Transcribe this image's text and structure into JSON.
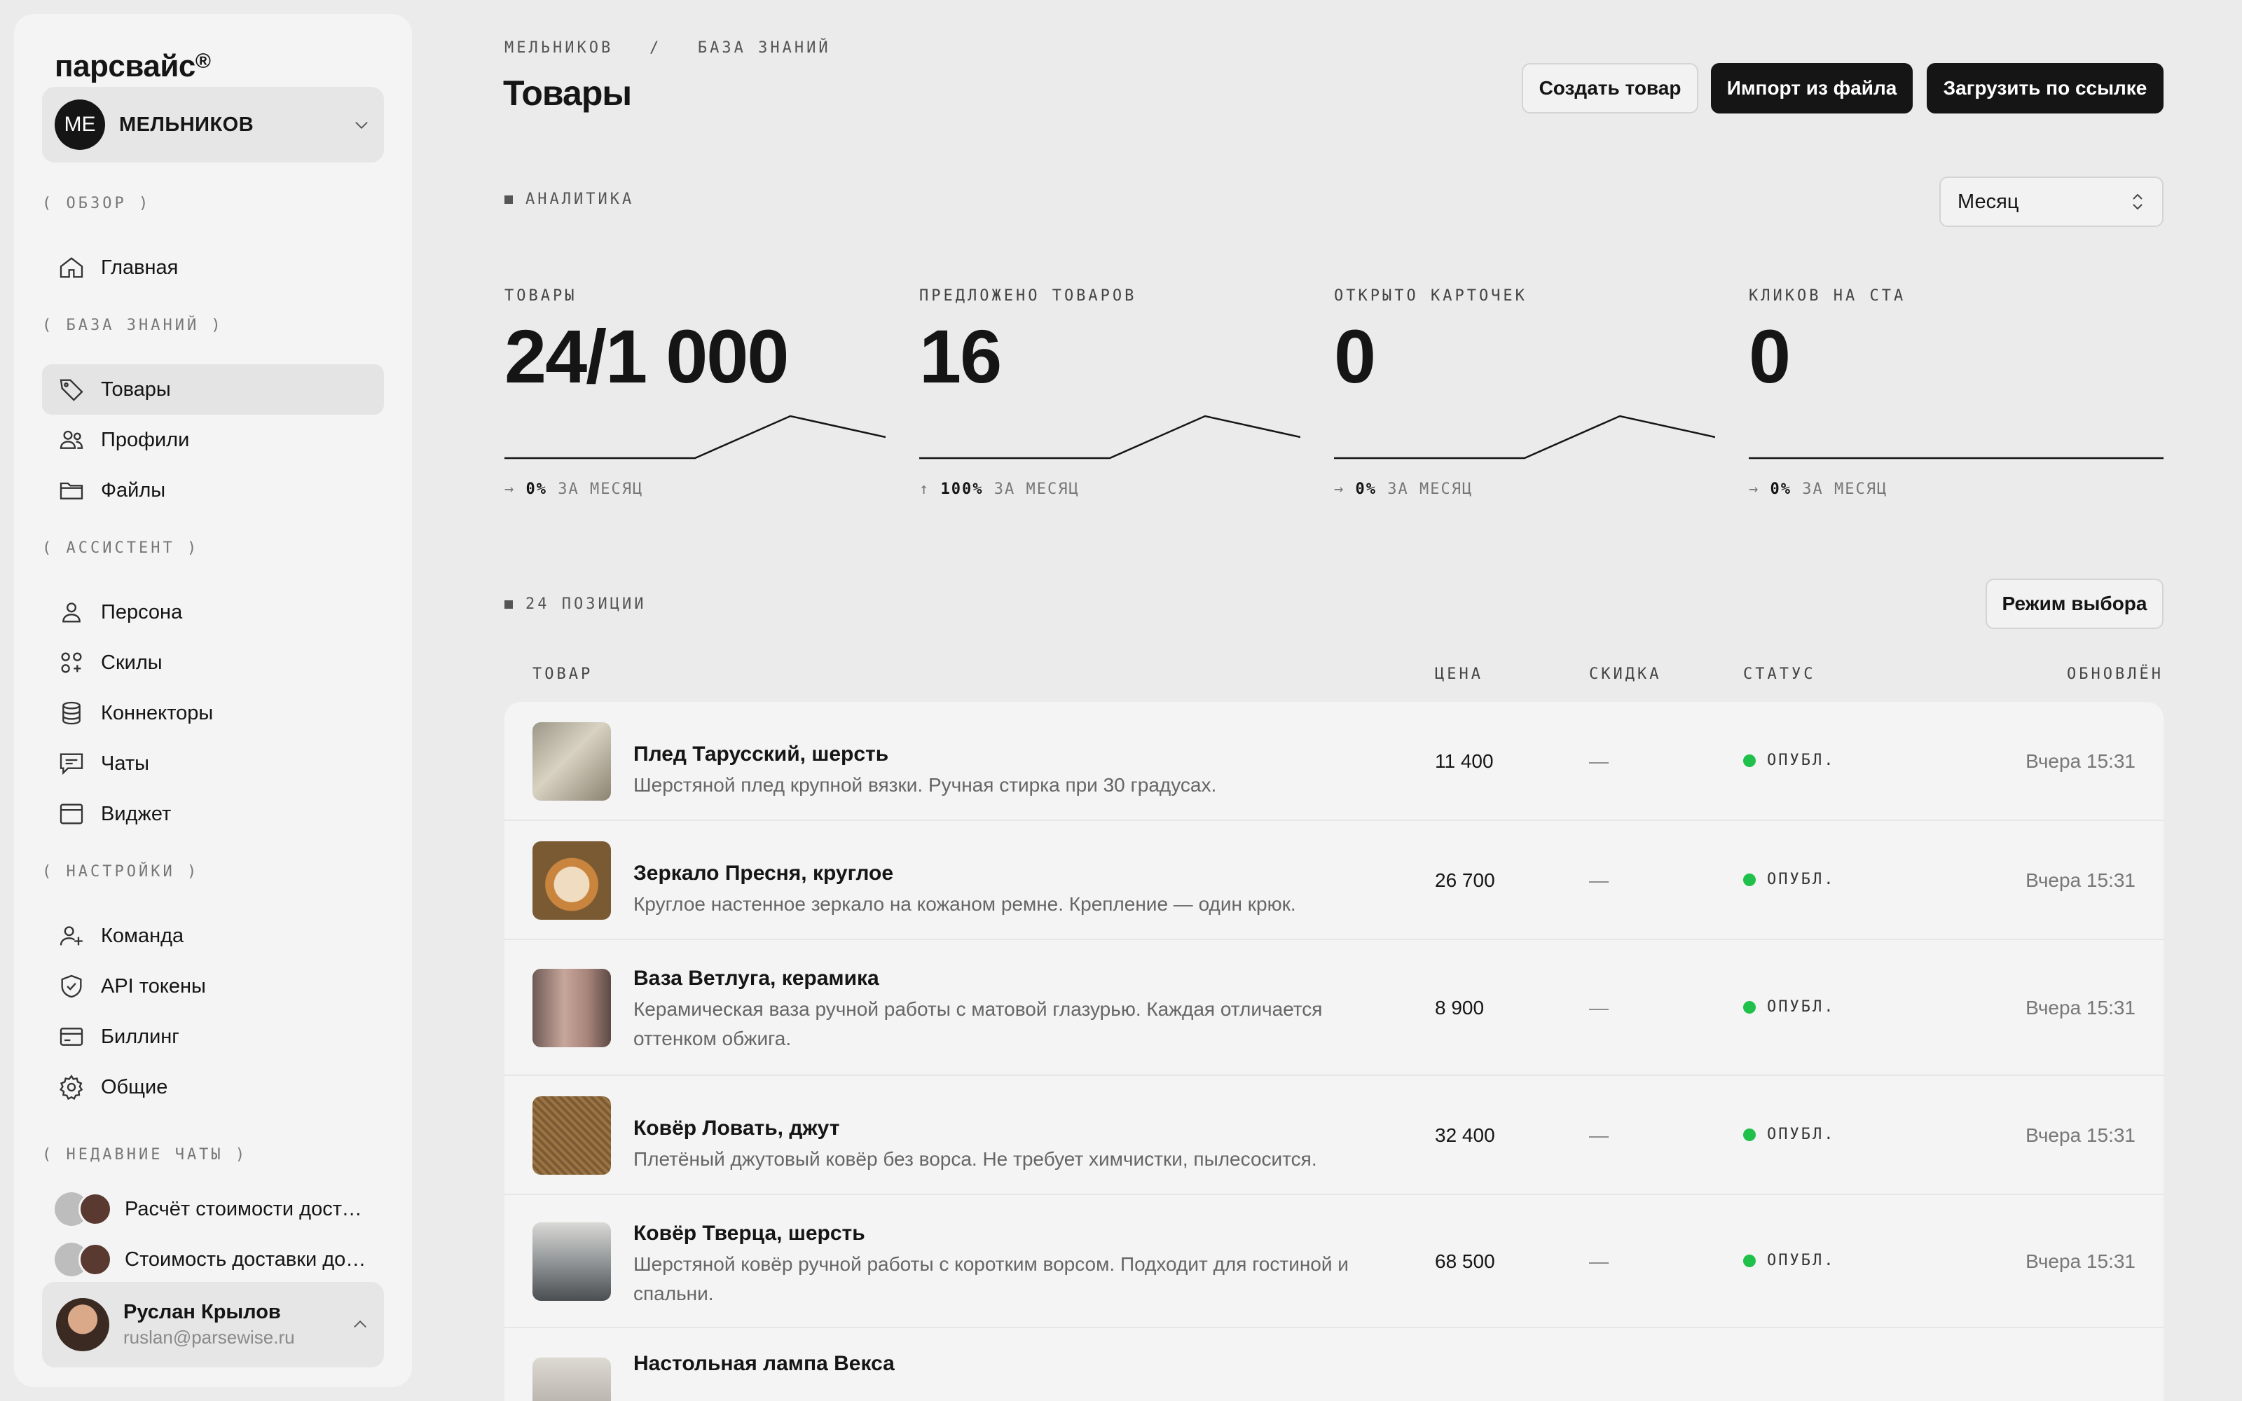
{
  "sidebar": {
    "logo": "парсвайс",
    "logo_mark": "®",
    "workspace": {
      "initials": "МЕ",
      "name": "МЕЛЬНИКОВ"
    },
    "sections": [
      {
        "label": "( ОБЗОР )",
        "items": [
          {
            "label": "Главная",
            "icon": "home-icon"
          }
        ]
      },
      {
        "label": "( БАЗА ЗНАНИЙ )",
        "items": [
          {
            "label": "Товары",
            "icon": "tag-icon",
            "active": true
          },
          {
            "label": "Профили",
            "icon": "users-icon"
          },
          {
            "label": "Файлы",
            "icon": "folder-icon"
          }
        ]
      },
      {
        "label": "( АССИСТЕНТ )",
        "items": [
          {
            "label": "Персона",
            "icon": "person-icon"
          },
          {
            "label": "Скилы",
            "icon": "grid-plus-icon"
          },
          {
            "label": "Коннекторы",
            "icon": "database-icon"
          },
          {
            "label": "Чаты",
            "icon": "chat-icon"
          },
          {
            "label": "Виджет",
            "icon": "window-icon"
          }
        ]
      },
      {
        "label": "( НАСТРОЙКИ )",
        "items": [
          {
            "label": "Команда",
            "icon": "add-user-icon"
          },
          {
            "label": "API токены",
            "icon": "shield-icon"
          },
          {
            "label": "Биллинг",
            "icon": "card-icon"
          },
          {
            "label": "Общие",
            "icon": "gear-icon"
          }
        ]
      }
    ],
    "recent_label": "( НЕДАВНИЕ ЧАТЫ )",
    "recent_chats": [
      "Расчёт стоимости доставки",
      "Стоимость доставки до склада"
    ],
    "user": {
      "name": "Руслан Крылов",
      "email": "ruslan@parsewise.ru"
    }
  },
  "header": {
    "breadcrumb": "МЕЛЬНИКОВ   /   БАЗА ЗНАНИЙ",
    "title": "Товары",
    "buttons": {
      "create": "Создать товар",
      "import": "Импорт из файла",
      "load_url": "Загрузить по ссылке"
    }
  },
  "analytics": {
    "label": "АНАЛИТИКА",
    "period": "Месяц",
    "metrics": [
      {
        "label": "ТОВАРЫ",
        "value": "24/1 000",
        "change": "0%",
        "period": "ЗА МЕСЯЦ",
        "arrow": "→",
        "trend": [
          0,
          0,
          1,
          0.5
        ]
      },
      {
        "label": "ПРЕДЛОЖЕНО ТОВАРОВ",
        "value": "16",
        "change": "100%",
        "period": "ЗА МЕСЯЦ",
        "arrow": "↑",
        "trend": [
          0,
          0,
          1,
          0.5
        ]
      },
      {
        "label": "ОТКРЫТО КАРТОЧЕК",
        "value": "0",
        "change": "0%",
        "period": "ЗА МЕСЯЦ",
        "arrow": "→",
        "trend": [
          0,
          0,
          1,
          0.5
        ]
      },
      {
        "label": "КЛИКОВ НА CTA",
        "value": "0",
        "change": "0%",
        "period": "ЗА МЕСЯЦ",
        "arrow": "→",
        "trend": [
          0,
          0,
          0,
          0
        ]
      }
    ]
  },
  "products": {
    "count_label": "24 ПОЗИЦИИ",
    "select_mode": "Режим выбора",
    "columns": {
      "product": "ТОВАР",
      "price": "ЦЕНА",
      "discount": "СКИДКА",
      "status": "СТАТУС",
      "updated": "ОБНОВЛЁН"
    },
    "rows": [
      {
        "title": "Плед Тарусский, шерсть",
        "desc": "Шерстяной плед крупной вязки. Ручная стирка при 30 градусах.",
        "price": "11 400",
        "discount": "—",
        "status": "ОПУБЛ.",
        "updated": "Вчера 15:31"
      },
      {
        "title": "Зеркало Пресня, круглое",
        "desc": "Круглое настенное зеркало на кожаном ремне. Крепление — один крюк.",
        "price": "26 700",
        "discount": "—",
        "status": "ОПУБЛ.",
        "updated": "Вчера 15:31"
      },
      {
        "title": "Ваза Ветлуга, керамика",
        "desc": "Керамическая ваза ручной работы с матовой глазурью. Каждая отличается оттенком обжига.",
        "price": "8 900",
        "discount": "—",
        "status": "ОПУБЛ.",
        "updated": "Вчера 15:31"
      },
      {
        "title": "Ковёр Ловать, джут",
        "desc": "Плетёный джутовый ковёр без ворса. Не требует химчистки, пылесосится.",
        "price": "32 400",
        "discount": "—",
        "status": "ОПУБЛ.",
        "updated": "Вчера 15:31"
      },
      {
        "title": "Ковёр Тверца, шерсть",
        "desc": "Шерстяной ковёр ручной работы с коротким ворсом. Подходит для гостиной и спальни.",
        "price": "68 500",
        "discount": "—",
        "status": "ОПУБЛ.",
        "updated": "Вчера 15:31"
      },
      {
        "title": "Настольная лампа Векса",
        "desc": "",
        "price": "",
        "discount": "",
        "status": "",
        "updated": ""
      }
    ]
  },
  "colors": {
    "accent_dark": "#151515",
    "status_published": "#1fc14a",
    "background": "#ebebeb"
  }
}
